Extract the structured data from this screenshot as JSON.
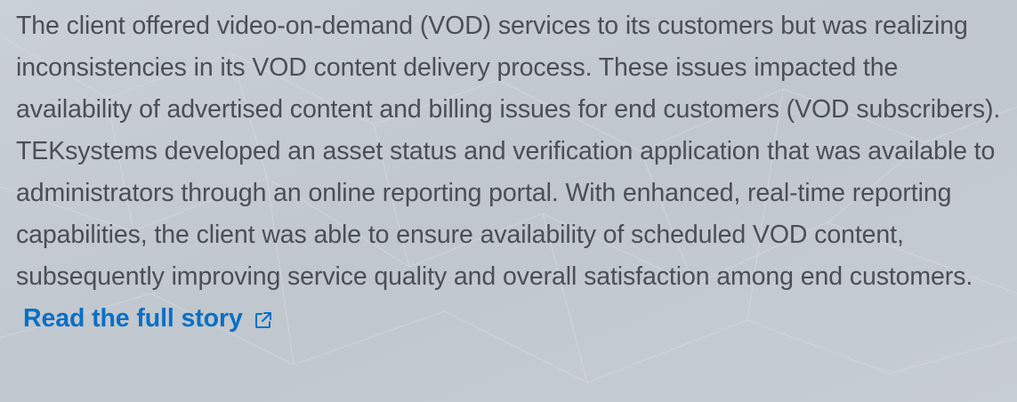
{
  "story": {
    "body": "The client offered video-on-demand (VOD) services to its customers but was realizing inconsistencies in its VOD content delivery process. These issues impacted the availability of advertised content and billing issues for end customers (VOD subscribers). TEKsystems developed an asset status and verification application that was available to administrators through an online reporting portal. With enhanced, real-time reporting capabilities, the client was able to ensure availability of scheduled VOD content, subsequently improving service quality and overall satisfaction among end customers.",
    "link_label": "Read the full story",
    "link_icon": "external-link-icon"
  },
  "colors": {
    "background": "#c3cad1",
    "text": "#4a4f55",
    "link": "#0b6fc4"
  }
}
